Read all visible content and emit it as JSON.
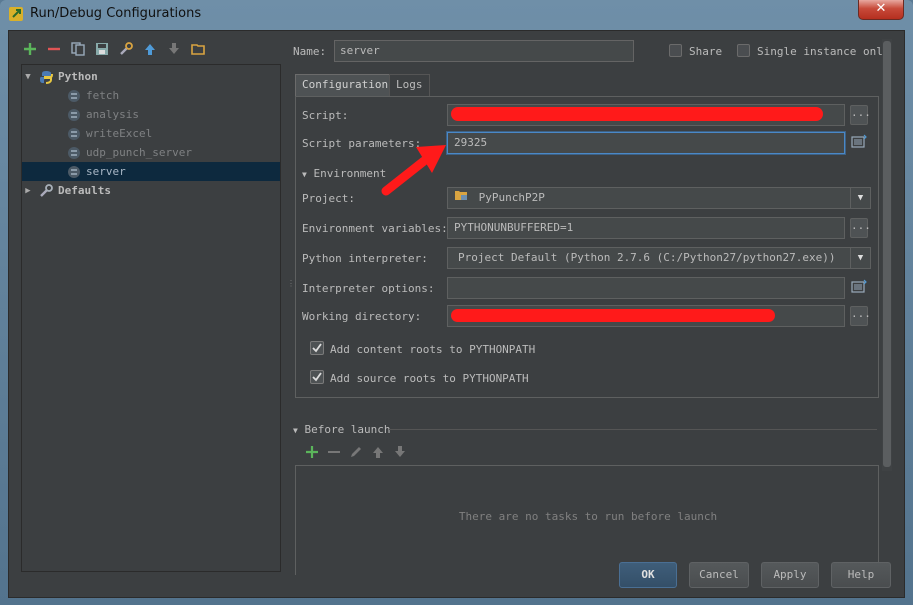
{
  "window": {
    "title": "Run/Debug Configurations",
    "close_label": "✕"
  },
  "tree": {
    "root_python": "Python",
    "items": [
      "fetch",
      "analysis",
      "writeExcel",
      "udp_punch_server",
      "server"
    ],
    "selected": "server",
    "root_defaults": "Defaults"
  },
  "header": {
    "name_label": "Name:",
    "name_value": "server",
    "share_label": "Share",
    "single_instance_label": "Single instance only"
  },
  "tabs": [
    {
      "label": "Configuration",
      "active": true
    },
    {
      "label": "Logs",
      "active": false
    }
  ],
  "config": {
    "script_label": "Script:",
    "script_params_label": "Script parameters:",
    "script_params_value": "29325",
    "environment_label": "Environment",
    "project_label": "Project:",
    "project_value": "PyPunchP2P",
    "env_vars_label": "Environment variables:",
    "env_vars_value": "PYTHONUNBUFFERED=1",
    "interpreter_label": "Python interpreter:",
    "interpreter_value": "Project Default (Python 2.7.6 (C:/Python27/python27.exe))",
    "interp_options_label": "Interpreter options:",
    "working_dir_label": "Working directory:",
    "add_content_roots_label": "Add content roots to PYTHONPATH",
    "add_source_roots_label": "Add source roots to PYTHONPATH"
  },
  "before_launch": {
    "title": "Before launch",
    "empty_text": "There are no tasks to run before launch"
  },
  "buttons": {
    "ok": "OK",
    "cancel": "Cancel",
    "apply": "Apply",
    "help": "Help"
  },
  "colors": {
    "accent_focus": "#4a88c7",
    "redaction": "#ff1a1a",
    "add_green": "#5bb55b",
    "remove_red": "#e05555",
    "arrow_blue": "#4f9bd8"
  }
}
